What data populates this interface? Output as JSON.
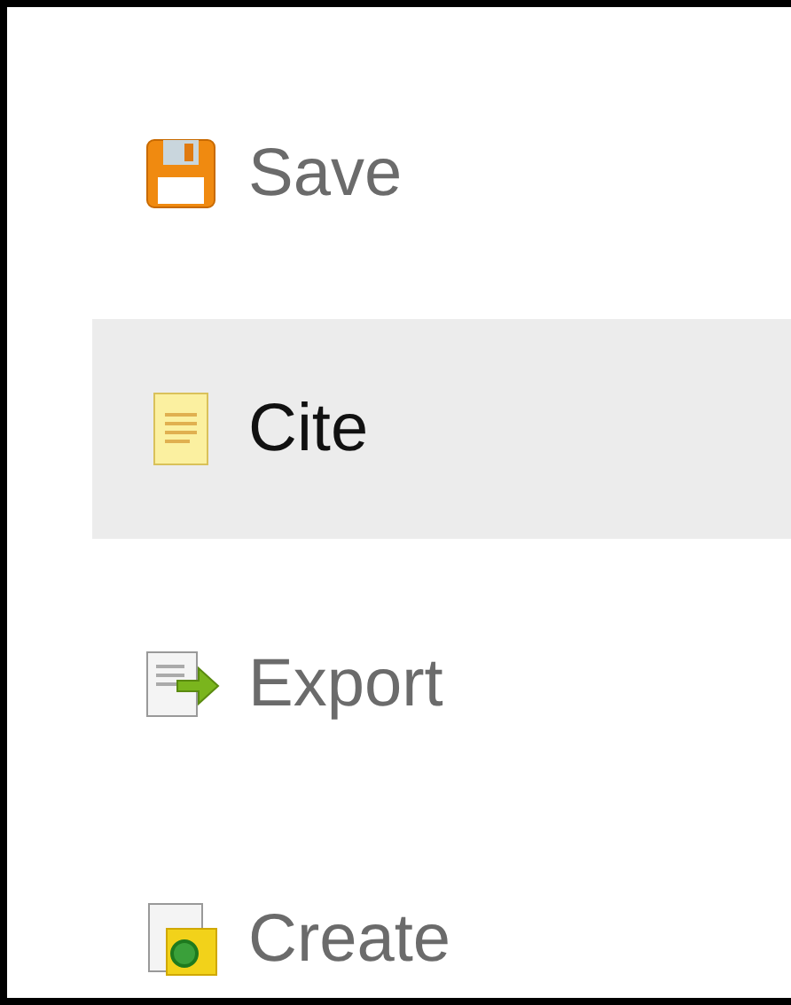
{
  "menu": [
    {
      "label": "Save",
      "kind": "save",
      "selected": false
    },
    {
      "label": "Cite",
      "kind": "cite",
      "selected": true
    },
    {
      "label": "Export",
      "kind": "export",
      "selected": false
    },
    {
      "label": "Create",
      "kind": "create",
      "selected": false
    }
  ]
}
